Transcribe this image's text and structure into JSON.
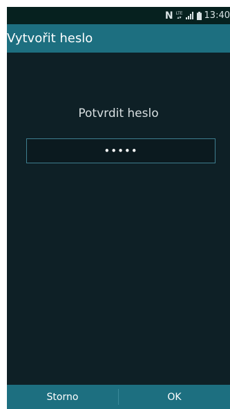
{
  "status_bar": {
    "nfc_icon": "N",
    "lte_label": "LTE",
    "clock": "13:40"
  },
  "action_bar": {
    "title": "Vytvořit heslo"
  },
  "dialog": {
    "prompt": "Potvrdit heslo",
    "password_value": "•••••"
  },
  "buttons": {
    "cancel_label": "Storno",
    "ok_label": "OK"
  },
  "colors": {
    "accent": "#1d6f80",
    "background": "#0f2127",
    "field_border": "#3f7f90"
  },
  "icons": [
    "nfc-icon",
    "lte-icon",
    "signal-icon",
    "battery-icon"
  ]
}
